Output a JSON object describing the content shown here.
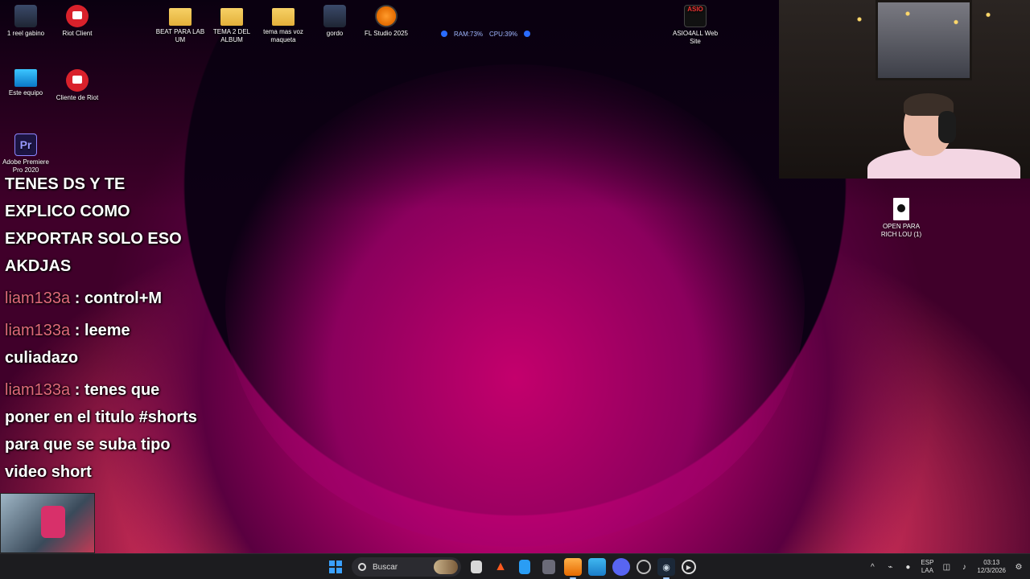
{
  "desktop": {
    "icons": [
      {
        "label": "1 reel gabino",
        "icon": "person-icon"
      },
      {
        "label": "Riot Client",
        "icon": "riot-icon"
      },
      {
        "label": "BEAT PARA LAB UM",
        "icon": "folder-icon"
      },
      {
        "label": "TEMA 2 DEL ALBUM",
        "icon": "folder-icon"
      },
      {
        "label": "tema mas voz maqueta",
        "icon": "folder-icon"
      },
      {
        "label": "gordo",
        "icon": "person-icon"
      },
      {
        "label": "FL Studio 2025",
        "icon": "flstudio-icon"
      },
      {
        "label": "ASIO4ALL Web Site",
        "icon": "asio-icon"
      },
      {
        "label": "Este equipo",
        "icon": "monitor-icon"
      },
      {
        "label": "Cliente de Riot",
        "icon": "riot-icon"
      },
      {
        "label": "Adobe Premiere Pro 2020",
        "icon": "premiere-icon"
      },
      {
        "label": "OPEN PARA RICH LOU (1)",
        "icon": "document-icon"
      }
    ]
  },
  "sysmon": {
    "ram": "RAM:73%",
    "cpu": "CPU:39%"
  },
  "chat": {
    "messages": [
      {
        "user": "",
        "text": "TENES DS Y TE EXPLICO COMO EXPORTAR SOLO ESO AKDJAS"
      },
      {
        "user": "liam133a",
        "text": " : control+M"
      },
      {
        "user": "liam133a",
        "text": " : leeme culiadazo"
      },
      {
        "user": "liam133a",
        "text": " : tenes que poner en el titulo #shorts para que se suba tipo video short"
      }
    ]
  },
  "taskbar": {
    "search_placeholder": "Buscar",
    "lang_line1": "ESP",
    "lang_line2": "LAA",
    "time": "03:13",
    "date": "12/3/2026"
  },
  "colors": {
    "chat_user": "#e06a7a",
    "taskbar_bg": "#1c1c1f",
    "accent": "#3aa0ff"
  }
}
